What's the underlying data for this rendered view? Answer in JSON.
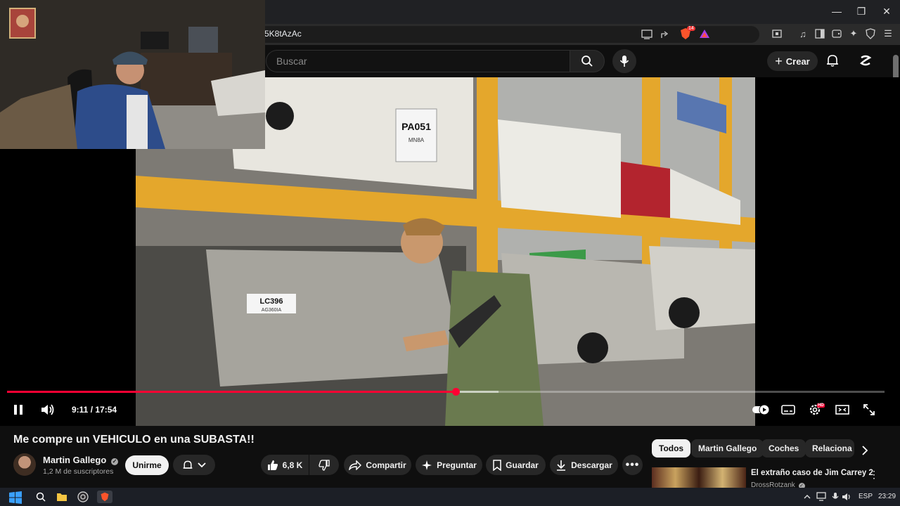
{
  "browser": {
    "url": "5K8tAzAc",
    "window_controls": {
      "minimize": "—",
      "restore": "❐",
      "close": "✕"
    },
    "icons": [
      "cast-icon",
      "share-icon",
      "brave-shield-icon",
      "rewards-icon",
      "media-icon",
      "sidebar-icon",
      "wallet-icon",
      "leo-icon",
      "vpn-icon",
      "menu-icon"
    ],
    "shield_badge": "14"
  },
  "youtube_header": {
    "search_placeholder": "Buscar",
    "create_label": "Crear"
  },
  "video": {
    "time": "9:11 / 17:54",
    "progress_fraction": 0.511,
    "buffer_fraction": 0.56,
    "plate_front": "PA051",
    "plate_front_sub": "MN8A",
    "plate_truck": "LC396",
    "plate_truck_sub": "AG360IA",
    "quality_badge": "HD"
  },
  "below_video": {
    "title": "Me compre un VEHICULO en una SUBASTA!!",
    "channel_name": "Martin Gallego",
    "subscribers": "1,2 M de suscriptores",
    "join_label": "Unirme",
    "like_count": "6,8 K",
    "share_label": "Compartir",
    "ask_label": "Preguntar",
    "save_label": "Guardar",
    "download_label": "Descargar"
  },
  "chips": [
    "Todos",
    "Martin Gallego",
    "Coches",
    "Relaciona"
  ],
  "recommendation": {
    "title": "El extraño caso de Jim Carrey 2",
    "channel": "DrossRotzank"
  },
  "taskbar": {
    "lang": "ESP",
    "clock": "23:29"
  },
  "colors": {
    "accent": "#ff0033",
    "bg": "#0f0f0f",
    "pill": "#272727"
  }
}
